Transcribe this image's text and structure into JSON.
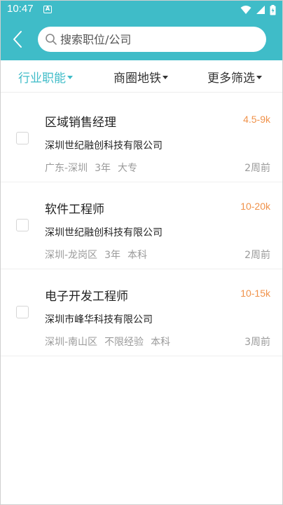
{
  "status_bar": {
    "time": "10:47",
    "notification_letter": "A"
  },
  "header": {
    "search_placeholder": "搜索职位/公司"
  },
  "filters": [
    {
      "label": "行业职能",
      "active": true
    },
    {
      "label": "商圈地铁",
      "active": false
    },
    {
      "label": "更多筛选",
      "active": false
    }
  ],
  "jobs": [
    {
      "title": "区域销售经理",
      "salary": "4.5-9k",
      "company": "深圳世纪融创科技有限公司",
      "location": "广东-深圳",
      "experience": "3年",
      "education": "大专",
      "posted": "2周前",
      "checked": false
    },
    {
      "title": "软件工程师",
      "salary": "10-20k",
      "company": "深圳世纪融创科技有限公司",
      "location": "深圳-龙岗区",
      "experience": "3年",
      "education": "本科",
      "posted": "2周前",
      "checked": false
    },
    {
      "title": "电子开发工程师",
      "salary": "10-15k",
      "company": "深圳市峰华科技有限公司",
      "location": "深圳-南山区",
      "experience": "不限经验",
      "education": "本科",
      "posted": "3周前",
      "checked": false
    }
  ],
  "colors": {
    "accent": "#3fbcc8",
    "salary": "#f0924a",
    "muted": "#9a9a9a"
  }
}
